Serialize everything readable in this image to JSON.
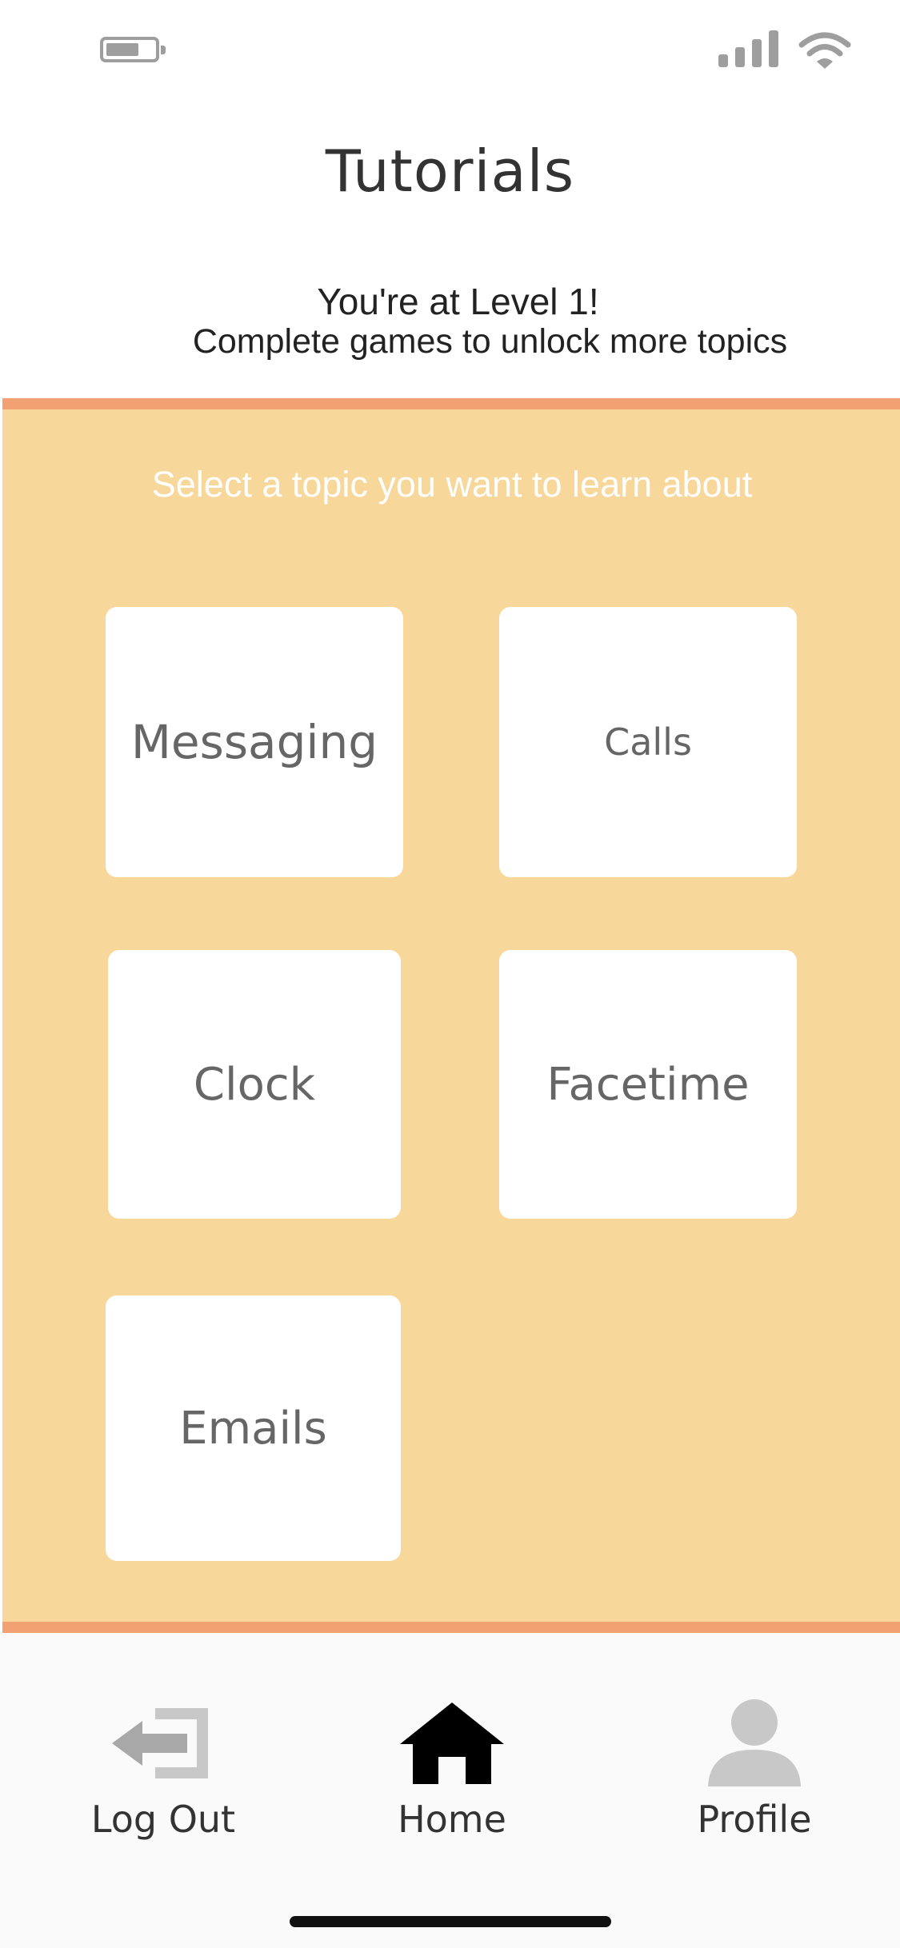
{
  "header": {
    "title": "Tutorials",
    "level_message": "You're at Level 1!",
    "unlock_message": "Complete games to unlock more topics"
  },
  "topics": {
    "prompt": "Select a topic you want to learn about",
    "items": [
      {
        "label": "Messaging"
      },
      {
        "label": "Calls"
      },
      {
        "label": "Clock"
      },
      {
        "label": "Facetime"
      },
      {
        "label": "Emails"
      }
    ]
  },
  "nav": {
    "logout_label": "Log Out",
    "home_label": "Home",
    "profile_label": "Profile",
    "logout_icon": "logout-icon",
    "home_icon": "home-icon",
    "profile_icon": "person-icon"
  },
  "colors": {
    "panel": "#f7d79a",
    "panel_border": "#f2a172",
    "active_icon": "#000000",
    "inactive_icon": "#c8c8c8"
  }
}
